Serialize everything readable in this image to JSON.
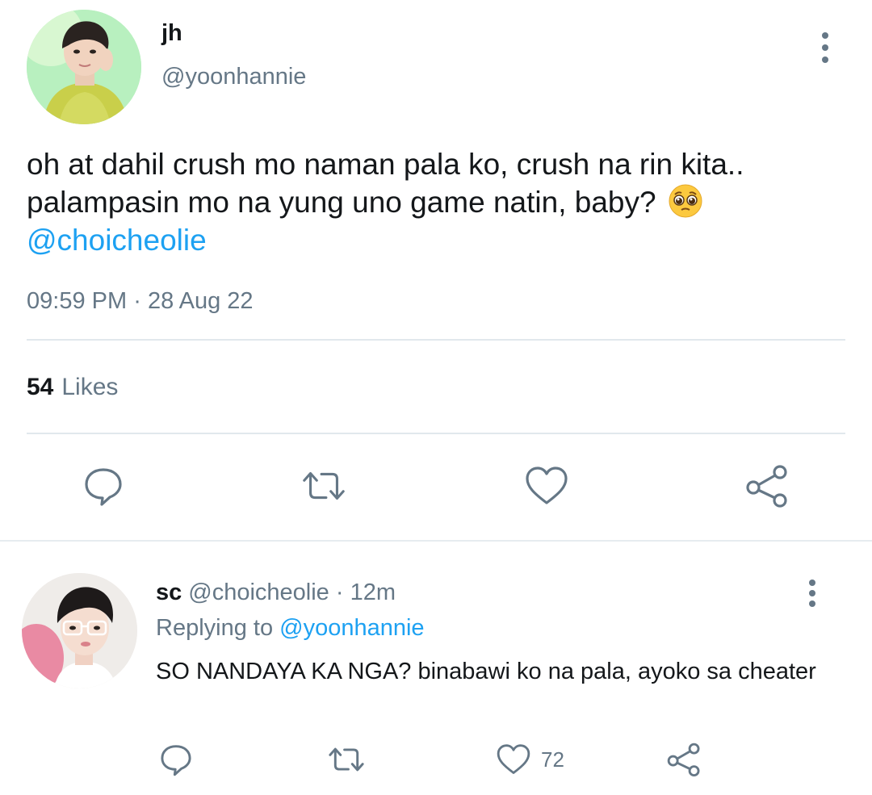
{
  "tweet": {
    "display_name": "jh",
    "handle": "@yoonhannie",
    "text_lines": [
      "oh at dahil crush mo naman pala ko, crush na rin kita..",
      "palampasin mo na yung uno game natin, baby?"
    ],
    "emoji": "pleading-face",
    "mention": "@choicheolie",
    "time": "09:59 PM",
    "separator": "·",
    "date": "28 Aug 22",
    "likes_count": "54",
    "likes_label": "Likes"
  },
  "reply": {
    "name": "sc",
    "handle": "@choicheolie",
    "separator": "·",
    "age": "12m",
    "replying_prefix": "Replying to",
    "replying_to": "@yoonhannie",
    "text": "SO NANDAYA KA NGA? binabawi ko na pala, ayoko sa cheater",
    "like_count": "72"
  },
  "colors": {
    "accent": "#1da1f2",
    "muted": "#657786",
    "text": "#14171a",
    "divider": "#e1e8ed"
  },
  "icons": {
    "reply": "reply-icon",
    "retweet": "retweet-icon",
    "like": "heart-icon",
    "share": "share-icon",
    "more": "more-vertical-icon"
  }
}
